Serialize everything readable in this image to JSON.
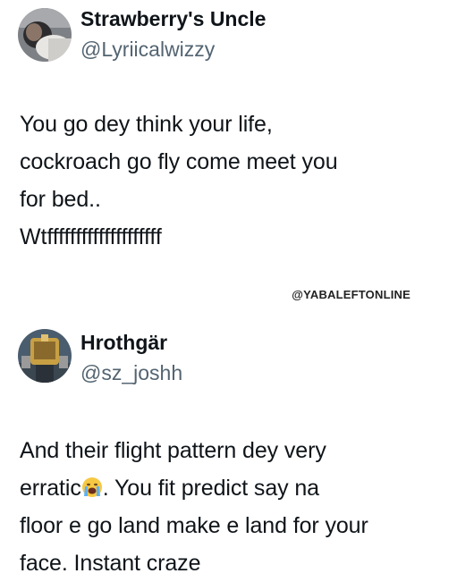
{
  "tweets": [
    {
      "name": "Strawberry's Uncle",
      "handle": "@Lyriicalwizzy",
      "text_lines": [
        "You go dey think your life,",
        "cockroach go fly come meet you",
        "for bed.."
      ],
      "text_line2": "Wtffffffffffffffffffff",
      "avatar_icon": "profile-photo-icon"
    },
    {
      "name": "Hrothgär",
      "handle": "@sz_joshh",
      "text_lines": [
        "And their flight pattern dey very",
        "erratic",
        ". You fit predict say na",
        "floor e go land make e land for your",
        "face. Instant craze"
      ],
      "emoji_icon": "loudly-crying-face-emoji",
      "avatar_icon": "game-character-avatar-icon"
    }
  ],
  "watermark": "@YABALEFTONLINE"
}
